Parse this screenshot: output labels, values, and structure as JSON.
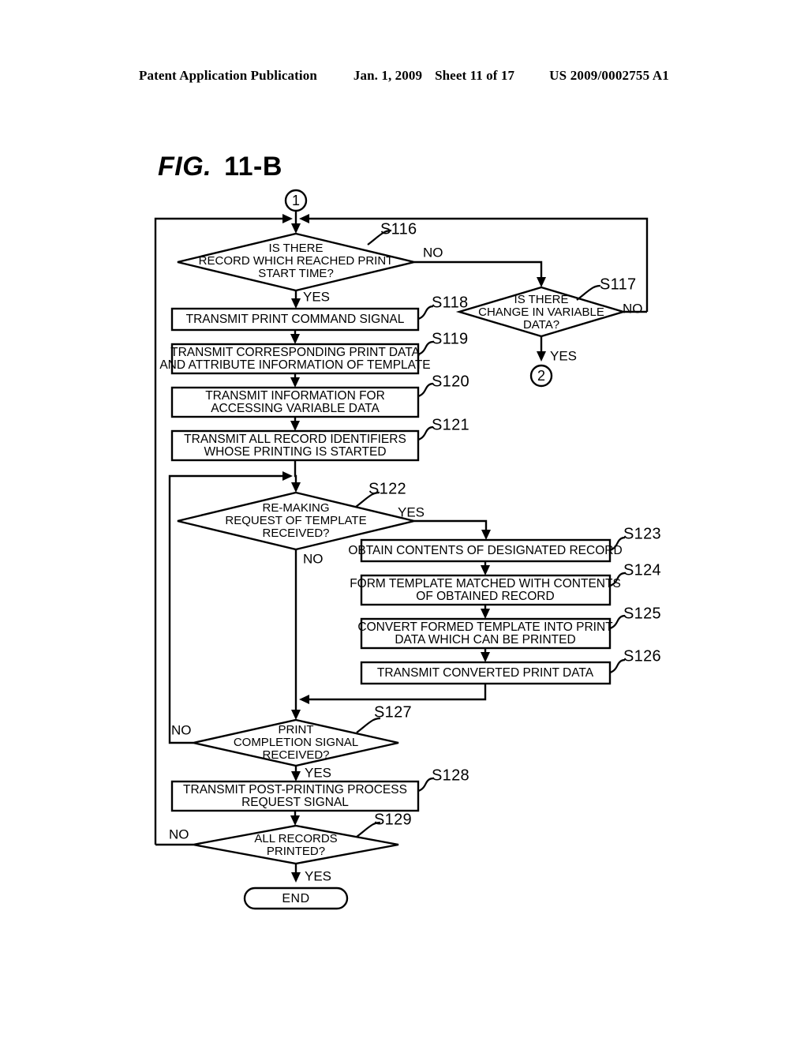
{
  "header": {
    "publication": "Patent Application Publication",
    "date": "Jan. 1, 2009",
    "sheet": "Sheet 11 of 17",
    "patent_number": "US 2009/0002755 A1"
  },
  "figure": {
    "label": "FIG.",
    "number": "11-B"
  },
  "connectors": {
    "in": "1",
    "out": "2"
  },
  "branches": {
    "s116_no": "NO",
    "s116_yes": "YES",
    "s117_no": "NO",
    "s117_yes": "YES",
    "s122_yes": "YES",
    "s122_no": "NO",
    "s127_no": "NO",
    "s127_yes": "YES",
    "s129_no": "NO",
    "s129_yes": "YES"
  },
  "terminator": {
    "end": "END"
  },
  "steps": [
    {
      "id": "S116",
      "type": "decision",
      "label": "S116",
      "lines": [
        "IS THERE",
        "RECORD WHICH REACHED PRINT",
        "START TIME?"
      ]
    },
    {
      "id": "S117",
      "type": "decision",
      "label": "S117",
      "lines": [
        "IS THERE",
        "CHANGE IN VARIABLE",
        "DATA?"
      ]
    },
    {
      "id": "S118",
      "type": "process",
      "label": "S118",
      "lines": [
        "TRANSMIT PRINT COMMAND SIGNAL"
      ]
    },
    {
      "id": "S119",
      "type": "process",
      "label": "S119",
      "lines": [
        "TRANSMIT CORRESPONDING PRINT DATA",
        "AND ATTRIBUTE INFORMATION OF TEMPLATE"
      ]
    },
    {
      "id": "S120",
      "type": "process",
      "label": "S120",
      "lines": [
        "TRANSMIT INFORMATION FOR",
        "ACCESSING VARIABLE DATA"
      ]
    },
    {
      "id": "S121",
      "type": "process",
      "label": "S121",
      "lines": [
        "TRANSMIT ALL RECORD IDENTIFIERS",
        "WHOSE PRINTING IS STARTED"
      ]
    },
    {
      "id": "S122",
      "type": "decision",
      "label": "S122",
      "lines": [
        "RE-MAKING",
        "REQUEST OF TEMPLATE",
        "RECEIVED?"
      ]
    },
    {
      "id": "S123",
      "type": "process",
      "label": "S123",
      "lines": [
        "OBTAIN CONTENTS OF DESIGNATED RECORD"
      ]
    },
    {
      "id": "S124",
      "type": "process",
      "label": "S124",
      "lines": [
        "FORM TEMPLATE MATCHED WITH CONTENTS",
        "OF OBTAINED RECORD"
      ]
    },
    {
      "id": "S125",
      "type": "process",
      "label": "S125",
      "lines": [
        "CONVERT FORMED TEMPLATE INTO PRINT",
        "DATA WHICH CAN BE PRINTED"
      ]
    },
    {
      "id": "S126",
      "type": "process",
      "label": "S126",
      "lines": [
        "TRANSMIT CONVERTED PRINT DATA"
      ]
    },
    {
      "id": "S127",
      "type": "decision",
      "label": "S127",
      "lines": [
        "PRINT",
        "COMPLETION SIGNAL",
        "RECEIVED?"
      ]
    },
    {
      "id": "S128",
      "type": "process",
      "label": "S128",
      "lines": [
        "TRANSMIT POST-PRINTING PROCESS",
        "REQUEST SIGNAL"
      ]
    },
    {
      "id": "S129",
      "type": "decision",
      "label": "S129",
      "lines": [
        "ALL RECORDS",
        "PRINTED?"
      ]
    }
  ]
}
